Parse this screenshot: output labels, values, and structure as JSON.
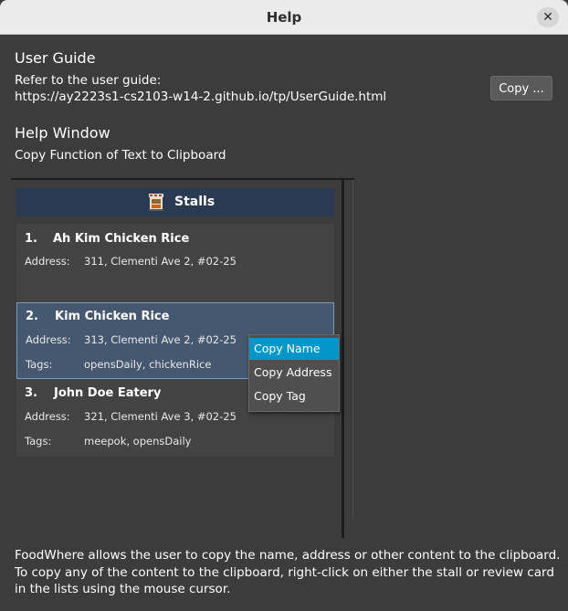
{
  "window": {
    "title": "Help",
    "close_glyph": "✕"
  },
  "user_guide": {
    "heading": "User Guide",
    "intro": "Refer to the user guide:",
    "url": "https://ay2223s1-cs2103-w14-2.github.io/tp/UserGuide.html",
    "copy_button": "Copy ..."
  },
  "help_window": {
    "heading": "Help Window",
    "subheading": "Copy Function of Text to Clipboard"
  },
  "stalls_panel": {
    "title": "Stalls",
    "icon": "stall-icon",
    "cards": [
      {
        "index": "1.",
        "name": "Ah Kim Chicken Rice",
        "address_label": "Address:",
        "address": "311, Clementi Ave 2, #02-25",
        "tags_label": "",
        "tags": ""
      },
      {
        "index": "2.",
        "name": "Kim Chicken Rice",
        "address_label": "Address:",
        "address": "313, Clementi Ave 2, #02-25",
        "tags_label": "Tags:",
        "tags": "opensDaily, chickenRice"
      },
      {
        "index": "3.",
        "name": "John Doe Eatery",
        "address_label": "Address:",
        "address": "321, Clementi Ave 3, #02-25",
        "tags_label": "Tags:",
        "tags": "meepok, opensDaily"
      }
    ]
  },
  "context_menu": {
    "items": [
      "Copy Name",
      "Copy Address",
      "Copy Tag"
    ],
    "active_index": 0
  },
  "footer": {
    "description": "FoodWhere allows the user to copy the name, address or other content to the clipboard. To copy any of the content to the clipboard, right-click on either the stall or review card in the lists using the mouse cursor."
  },
  "colors": {
    "background": "#3c3c3c",
    "panel_header": "#2a3a52",
    "selected_card": "#465870",
    "menu_highlight": "#0096c9"
  }
}
